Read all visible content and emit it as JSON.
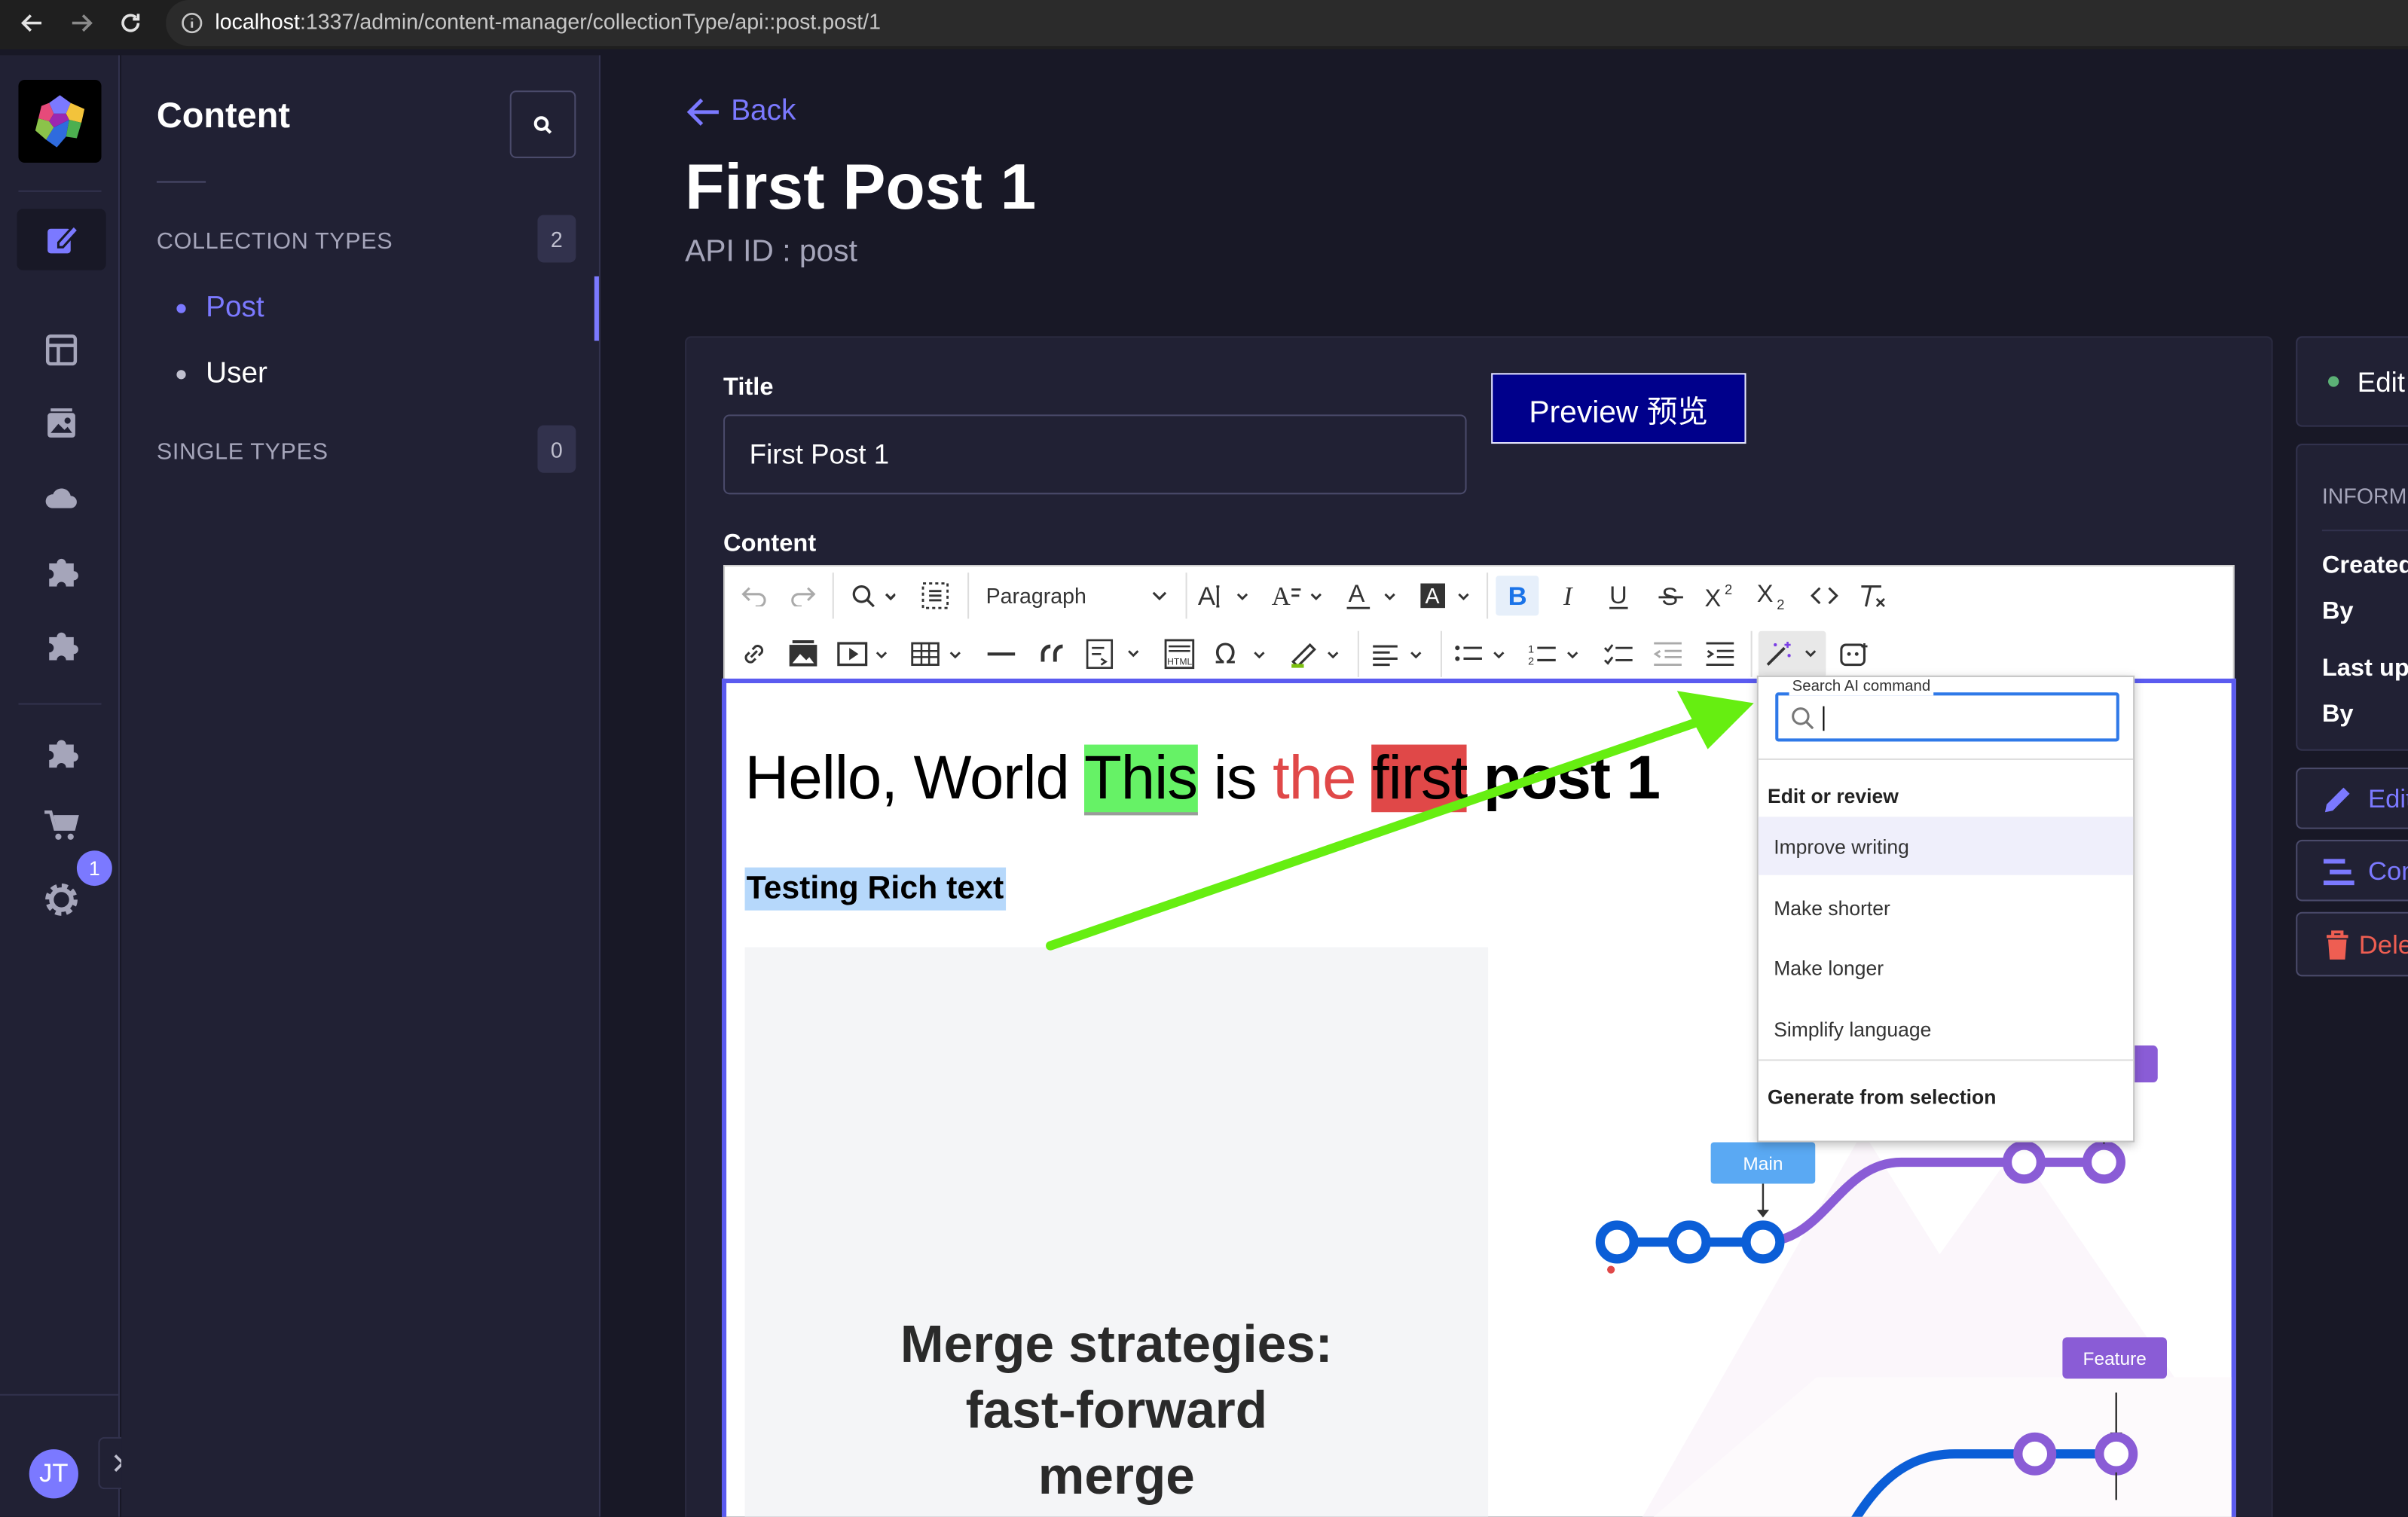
{
  "browser": {
    "url_host": "localhost",
    "url_path": ":1337/admin/content-manager/collectionType/api::post.post/1"
  },
  "rail": {
    "user_initials": "JT",
    "settings_badge": "1"
  },
  "subnav": {
    "title": "Content",
    "collection_types_label": "COLLECTION TYPES",
    "collection_types_count": "2",
    "collection_items": [
      "Post",
      "User"
    ],
    "single_types_label": "SINGLE TYPES",
    "single_types_count": "0"
  },
  "header": {
    "back_label": "Back",
    "title": "First Post 1",
    "api_id": "API ID : post"
  },
  "form": {
    "title_label": "Title",
    "title_value": "First Post 1",
    "preview_label": "Preview 预览",
    "content_label": "Content"
  },
  "toolbar": {
    "heading_select": "Paragraph"
  },
  "editor": {
    "line1": {
      "part1": "Hello, World ",
      "part2": "This",
      "part3": " is ",
      "part4": "the ",
      "part5": "first",
      "part6": " post 1"
    },
    "line2": "Testing Rich text",
    "image1_text": [
      "Merge strategies:",
      "fast-forward",
      "merge"
    ],
    "image2_tags": {
      "main": "Main",
      "feature": "Feature"
    }
  },
  "ai_menu": {
    "search_legend": "Search AI command",
    "section1": "Edit or review",
    "items": [
      "Improve writing",
      "Make shorter",
      "Make longer",
      "Simplify language"
    ],
    "section2": "Generate from selection"
  },
  "side": {
    "status_label": "Edit",
    "info_label": "INFORM",
    "created_label": "Created",
    "created_by": "By",
    "updated_label": "Last up",
    "updated_by": "By",
    "edit_button": "Edit",
    "configure_button": "Con",
    "delete_button": "Dele"
  },
  "colors": {
    "accent": "#7b79ff",
    "preview_bg": "#00008b",
    "highlight_green": "#66f266",
    "highlight_red": "#e04848",
    "arrow": "#66ee11"
  }
}
